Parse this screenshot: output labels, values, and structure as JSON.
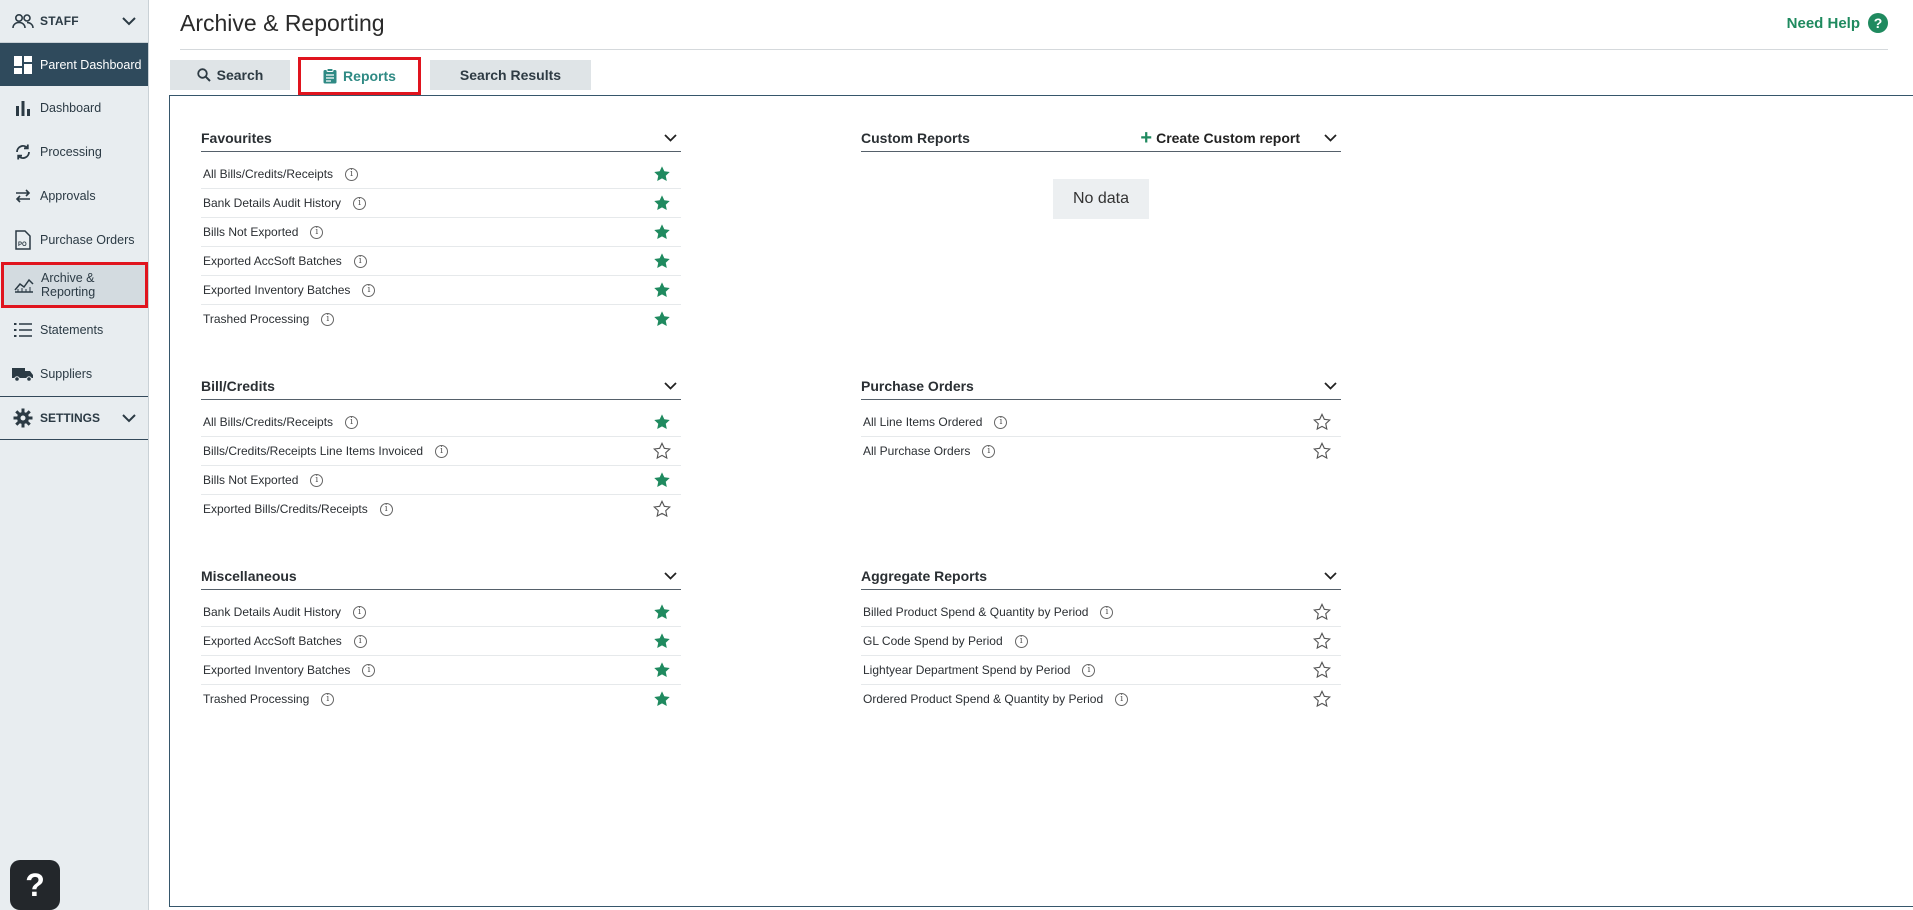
{
  "sidebar": {
    "staff_label": "STAFF",
    "parent_dashboard": "Parent Dashboard",
    "items": [
      {
        "label": "Dashboard",
        "icon": "bar-chart-icon"
      },
      {
        "label": "Processing",
        "icon": "refresh-icon"
      },
      {
        "label": "Approvals",
        "icon": "swap-arrows-icon"
      },
      {
        "label": "Purchase Orders",
        "icon": "po-document-icon"
      },
      {
        "label": "Archive & Reporting",
        "icon": "line-chart-icon"
      },
      {
        "label": "Statements",
        "icon": "list-icon"
      },
      {
        "label": "Suppliers",
        "icon": "truck-icon"
      }
    ],
    "settings_label": "SETTINGS",
    "help_fab": "?"
  },
  "header": {
    "title": "Archive & Reporting",
    "need_help": "Need Help",
    "help_glyph": "?"
  },
  "tabs": {
    "search": "Search",
    "reports": "Reports",
    "results": "Search Results"
  },
  "sections": {
    "favourites": {
      "title": "Favourites",
      "rows": [
        {
          "label": "All Bills/Credits/Receipts",
          "starred": true
        },
        {
          "label": "Bank Details Audit History",
          "starred": true
        },
        {
          "label": "Bills Not Exported",
          "starred": true
        },
        {
          "label": "Exported AccSoft Batches",
          "starred": true
        },
        {
          "label": "Exported Inventory Batches",
          "starred": true
        },
        {
          "label": "Trashed Processing",
          "starred": true
        }
      ]
    },
    "custom": {
      "title": "Custom Reports",
      "create_label": "Create Custom report",
      "empty_text": "No data"
    },
    "bills": {
      "title": "Bill/Credits",
      "rows": [
        {
          "label": "All Bills/Credits/Receipts",
          "starred": true
        },
        {
          "label": "Bills/Credits/Receipts Line Items Invoiced",
          "starred": false
        },
        {
          "label": "Bills Not Exported",
          "starred": true
        },
        {
          "label": "Exported Bills/Credits/Receipts",
          "starred": false
        }
      ]
    },
    "purchase_orders": {
      "title": "Purchase Orders",
      "rows": [
        {
          "label": "All Line Items Ordered",
          "starred": false
        },
        {
          "label": "All Purchase Orders",
          "starred": false
        }
      ]
    },
    "misc": {
      "title": "Miscellaneous",
      "rows": [
        {
          "label": "Bank Details Audit History",
          "starred": true
        },
        {
          "label": "Exported AccSoft Batches",
          "starred": true
        },
        {
          "label": "Exported Inventory Batches",
          "starred": true
        },
        {
          "label": "Trashed Processing",
          "starred": true
        }
      ]
    },
    "aggregate": {
      "title": "Aggregate Reports",
      "rows": [
        {
          "label": "Billed Product Spend & Quantity by Period",
          "starred": false
        },
        {
          "label": "GL Code Spend by Period",
          "starred": false
        },
        {
          "label": "Lightyear Department Spend by Period",
          "starred": false
        },
        {
          "label": "Ordered Product Spend & Quantity by Period",
          "starred": false
        }
      ]
    }
  },
  "info_glyph": "i",
  "colors": {
    "accent_green": "#1f8a5f",
    "sidebar_active": "#2f4a5c",
    "highlight_red": "#e0141e"
  }
}
